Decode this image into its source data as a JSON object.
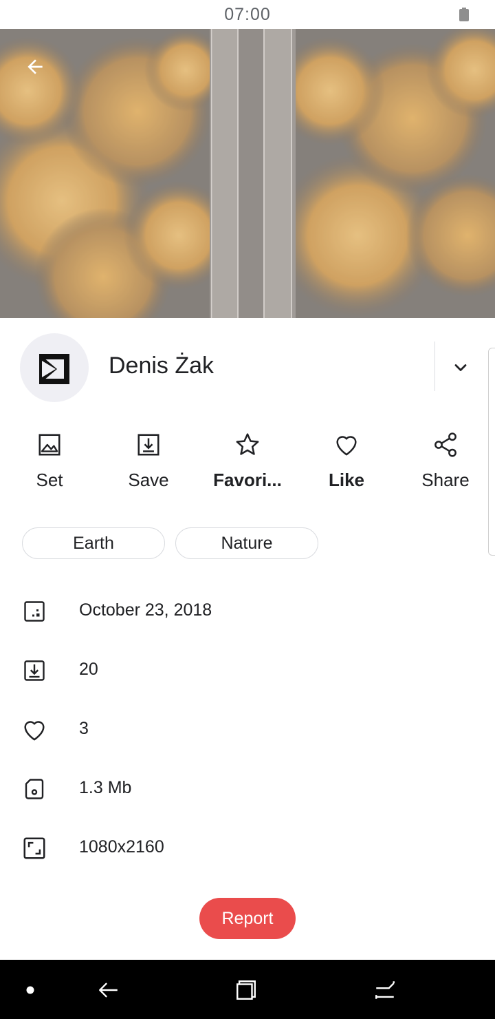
{
  "status_bar": {
    "time": "07:00",
    "battery_icon": "battery-icon"
  },
  "photo": {
    "description_icon": "photo-image",
    "back_icon": "arrow-left-icon"
  },
  "author": {
    "name": "Denis Żak",
    "avatar_icon": "author-logo-icon",
    "expand_icon": "chevron-down-icon"
  },
  "actions": [
    {
      "label": "Set",
      "icon": "image-icon"
    },
    {
      "label": "Save",
      "icon": "download-icon"
    },
    {
      "label": "Favori...",
      "icon": "star-icon"
    },
    {
      "label": "Like",
      "icon": "heart-icon"
    },
    {
      "label": "Share",
      "icon": "share-icon"
    }
  ],
  "tags": [
    "Earth",
    "Nature"
  ],
  "details": [
    {
      "icon": "date-icon",
      "value": "October 23, 2018"
    },
    {
      "icon": "download-icon",
      "value": "20"
    },
    {
      "icon": "heart-icon",
      "value": "3"
    },
    {
      "icon": "file-size-icon",
      "value": "1.3 Mb"
    },
    {
      "icon": "resolution-icon",
      "value": "1080x2160"
    }
  ],
  "report_button": {
    "label": "Report",
    "color": "#ea4c4c"
  },
  "nav_bar": {
    "icons": [
      "dot-icon",
      "back-icon",
      "recents-icon",
      "overview-icon"
    ]
  }
}
